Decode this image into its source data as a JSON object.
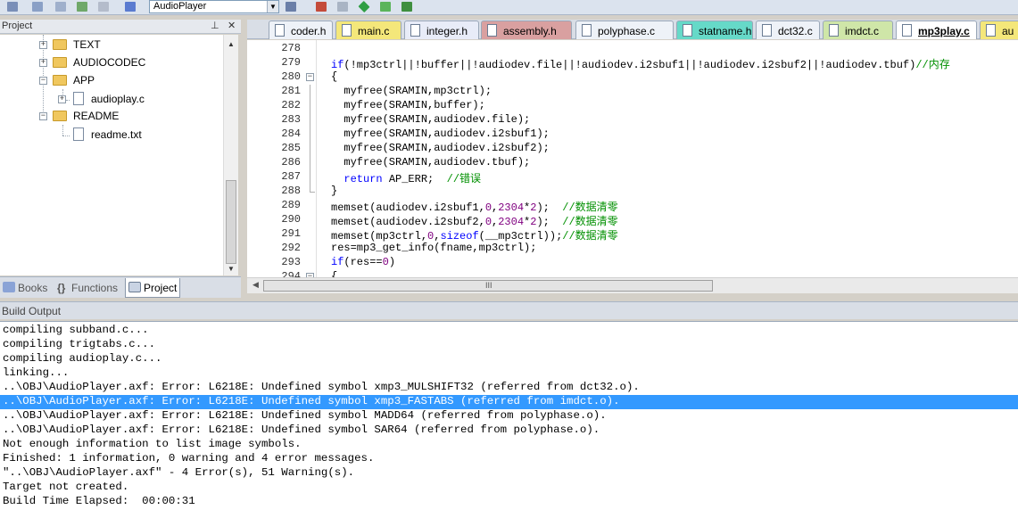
{
  "toolbar": {
    "target_name": "AudioPlayer",
    "icons": [
      "load-icon",
      "save-icon",
      "layers-icon",
      "books-icon",
      "window-icon",
      "build-target-icon",
      "target-options-icon",
      "packs-icon",
      "components-icon",
      "diamond-icon",
      "wrench-icon",
      "manage-icon"
    ]
  },
  "project_panel": {
    "title": "Project",
    "tree": [
      {
        "label": "TEXT",
        "type": "folder",
        "state": "collapsed"
      },
      {
        "label": "AUDIOCODEC",
        "type": "folder",
        "state": "collapsed"
      },
      {
        "label": "APP",
        "type": "folder",
        "state": "expanded"
      },
      {
        "label": "audioplay.c",
        "type": "file",
        "state": "collapsed"
      },
      {
        "label": "README",
        "type": "folder",
        "state": "expanded"
      },
      {
        "label": "readme.txt",
        "type": "file"
      }
    ],
    "tabs": [
      {
        "label": "Books",
        "icon": "book-icon"
      },
      {
        "label": "Functions",
        "icon": "braces-icon"
      },
      {
        "label": "Project",
        "icon": "project-icon",
        "active": true
      }
    ]
  },
  "editor": {
    "tabs": [
      {
        "label": "coder.h",
        "color": "#eef2f8"
      },
      {
        "label": "main.c",
        "color": "#f4e77a"
      },
      {
        "label": "integer.h",
        "color": "#e8ecf8"
      },
      {
        "label": "assembly.h",
        "color": "#d9a0a0"
      },
      {
        "label": "polyphase.c",
        "color": "#eef2f8"
      },
      {
        "label": "statname.h",
        "color": "#66d9c8"
      },
      {
        "label": "dct32.c",
        "color": "#eef2f8"
      },
      {
        "label": "imdct.c",
        "color": "#cfe6a8"
      },
      {
        "label": "mp3play.c",
        "color": "#ffffff",
        "active": true
      },
      {
        "label": "au",
        "color": "#f4e77a"
      }
    ],
    "lines": [
      {
        "num": "278",
        "code": ""
      },
      {
        "num": "279",
        "code": "if(!mp3ctrl||!buffer||!audiodev.file||!audiodev.i2sbuf1||!audiodev.i2sbuf2||!audiodev.tbuf)//内存"
      },
      {
        "num": "280",
        "code": "{"
      },
      {
        "num": "281",
        "code": "  myfree(SRAMIN,mp3ctrl);"
      },
      {
        "num": "282",
        "code": "  myfree(SRAMIN,buffer);"
      },
      {
        "num": "283",
        "code": "  myfree(SRAMIN,audiodev.file);"
      },
      {
        "num": "284",
        "code": "  myfree(SRAMIN,audiodev.i2sbuf1);"
      },
      {
        "num": "285",
        "code": "  myfree(SRAMIN,audiodev.i2sbuf2);"
      },
      {
        "num": "286",
        "code": "  myfree(SRAMIN,audiodev.tbuf);"
      },
      {
        "num": "287",
        "code": "  return AP_ERR;  //错误"
      },
      {
        "num": "288",
        "code": "}"
      },
      {
        "num": "289",
        "code": "memset(audiodev.i2sbuf1,0,2304*2);  //数据清零"
      },
      {
        "num": "290",
        "code": "memset(audiodev.i2sbuf2,0,2304*2);  //数据清零"
      },
      {
        "num": "291",
        "code": "memset(mp3ctrl,0,sizeof(__mp3ctrl));//数据清零"
      },
      {
        "num": "292",
        "code": "res=mp3_get_info(fname,mp3ctrl);"
      },
      {
        "num": "293",
        "code": "if(res==0)"
      },
      {
        "num": "294",
        "code": "{"
      }
    ],
    "scroll_grip": "III"
  },
  "build_output": {
    "title": "Build Output",
    "selected_index": 5,
    "lines": [
      "compiling subband.c...",
      "compiling trigtabs.c...",
      "compiling audioplay.c...",
      "linking...",
      "..\\OBJ\\AudioPlayer.axf: Error: L6218E: Undefined symbol xmp3_MULSHIFT32 (referred from dct32.o).",
      "..\\OBJ\\AudioPlayer.axf: Error: L6218E: Undefined symbol xmp3_FASTABS (referred from imdct.o).",
      "..\\OBJ\\AudioPlayer.axf: Error: L6218E: Undefined symbol MADD64 (referred from polyphase.o).",
      "..\\OBJ\\AudioPlayer.axf: Error: L6218E: Undefined symbol SAR64 (referred from polyphase.o).",
      "Not enough information to list image symbols.",
      "Finished: 1 information, 0 warning and 4 error messages.",
      "\"..\\OBJ\\AudioPlayer.axf\" - 4 Error(s), 51 Warning(s).",
      "Target not created.",
      "Build Time Elapsed:  00:00:31"
    ]
  },
  "colors": {
    "keyword": "#0000ff",
    "comment": "#009000",
    "number": "#800080",
    "selection": "#3399ff"
  }
}
